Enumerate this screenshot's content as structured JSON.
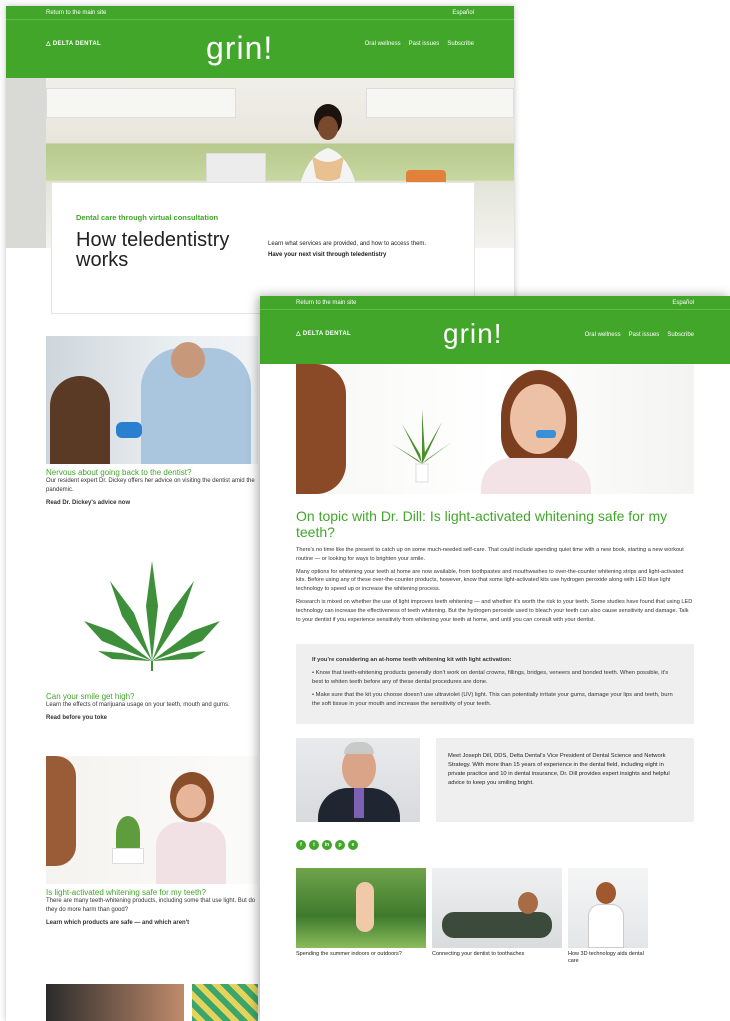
{
  "colors": {
    "brand": "#41a62a"
  },
  "back": {
    "topbar": {
      "left": "Return to the main site",
      "right": "Español"
    },
    "logo": "DELTA DENTAL",
    "brand": "grin!",
    "nav": [
      "Oral wellness",
      "Past issues",
      "Subscribe"
    ],
    "card": {
      "kicker": "Dental care through virtual consultation",
      "title": "How teledentistry works",
      "desc": "Learn what services are provided, and how to access them.",
      "link": "Have your next visit through teledentistry"
    },
    "articles": [
      {
        "title": "Nervous about going back to the dentist?",
        "body": "Our resident expert Dr. Dickey offers her advice on visiting the dentist amid the pandemic.",
        "link": "Read Dr. Dickey's advice now"
      },
      {
        "title": "Can your smile get high?",
        "body": "Learn the effects of marijuana usage on your teeth, mouth and gums.",
        "link": "Read before you toke"
      },
      {
        "title": "Is light-activated whitening safe for my teeth?",
        "body": "There are many teeth-whitening products, including some that use light. But do they do more harm than good?",
        "link": "Learn which products are safe — and which aren't"
      }
    ]
  },
  "front": {
    "topbar": {
      "left": "Return to the main site",
      "right": "Español"
    },
    "logo": "DELTA DENTAL",
    "brand": "grin!",
    "nav": [
      "Oral wellness",
      "Past issues",
      "Subscribe"
    ],
    "title": "On topic with Dr. Dill: Is light-activated whitening safe for my teeth?",
    "paras": [
      "There's no time like the present to catch up on some much-needed self-care. That could include spending quiet time with a new book, starting a new workout routine — or looking for ways to brighten your smile.",
      "Many options for whitening your teeth at home are now available, from toothpastes and mouthwashes to over-the-counter whitening strips and light-activated kits. Before using any of these over-the-counter products, however, know that some light-activated kits use hydrogen peroxide along with LED blue light technology to speed up or increase the whitening process.",
      "Research is mixed on whether the use of light improves teeth whitening — and whether it's worth the risk to your teeth. Some studies have found that using LED technology can increase the effectiveness of teeth whitening. But the hydrogen peroxide used to bleach your teeth can also cause sensitivity and damage. Talk to your dentist if you experience sensitivity from whitening your teeth at home, and until you can consult with your dentist."
    ],
    "box": {
      "lead": "If you're considering an at-home teeth whitening kit with light activation:",
      "b1": "Know that teeth-whitening products generally don't work on dental crowns, fillings, bridges, veneers and bonded teeth. When possible, it's best to whiten teeth before any of these dental procedures are done.",
      "b2": "Make sure that the kit you choose doesn't use ultraviolet (UV) light. This can potentially irritate your gums, damage your lips and teeth, burn the soft tissue in your mouth and increase the sensitivity of your teeth."
    },
    "bio": "Meet Joseph Dill, DDS, Delta Dental's Vice President of Dental Science and Network Strategy. With more than 15 years of experience in the dental field, including eight in private practice and 10 in dental insurance, Dr. Dill provides expert insights and helpful advice to keep you smiling bright.",
    "social": [
      "f",
      "t",
      "in",
      "p",
      "e"
    ],
    "thumbs": [
      "Spending the summer indoors or outdoors?",
      "Connecting your dentist to toothaches",
      "How 3D technology aids dental care"
    ]
  }
}
